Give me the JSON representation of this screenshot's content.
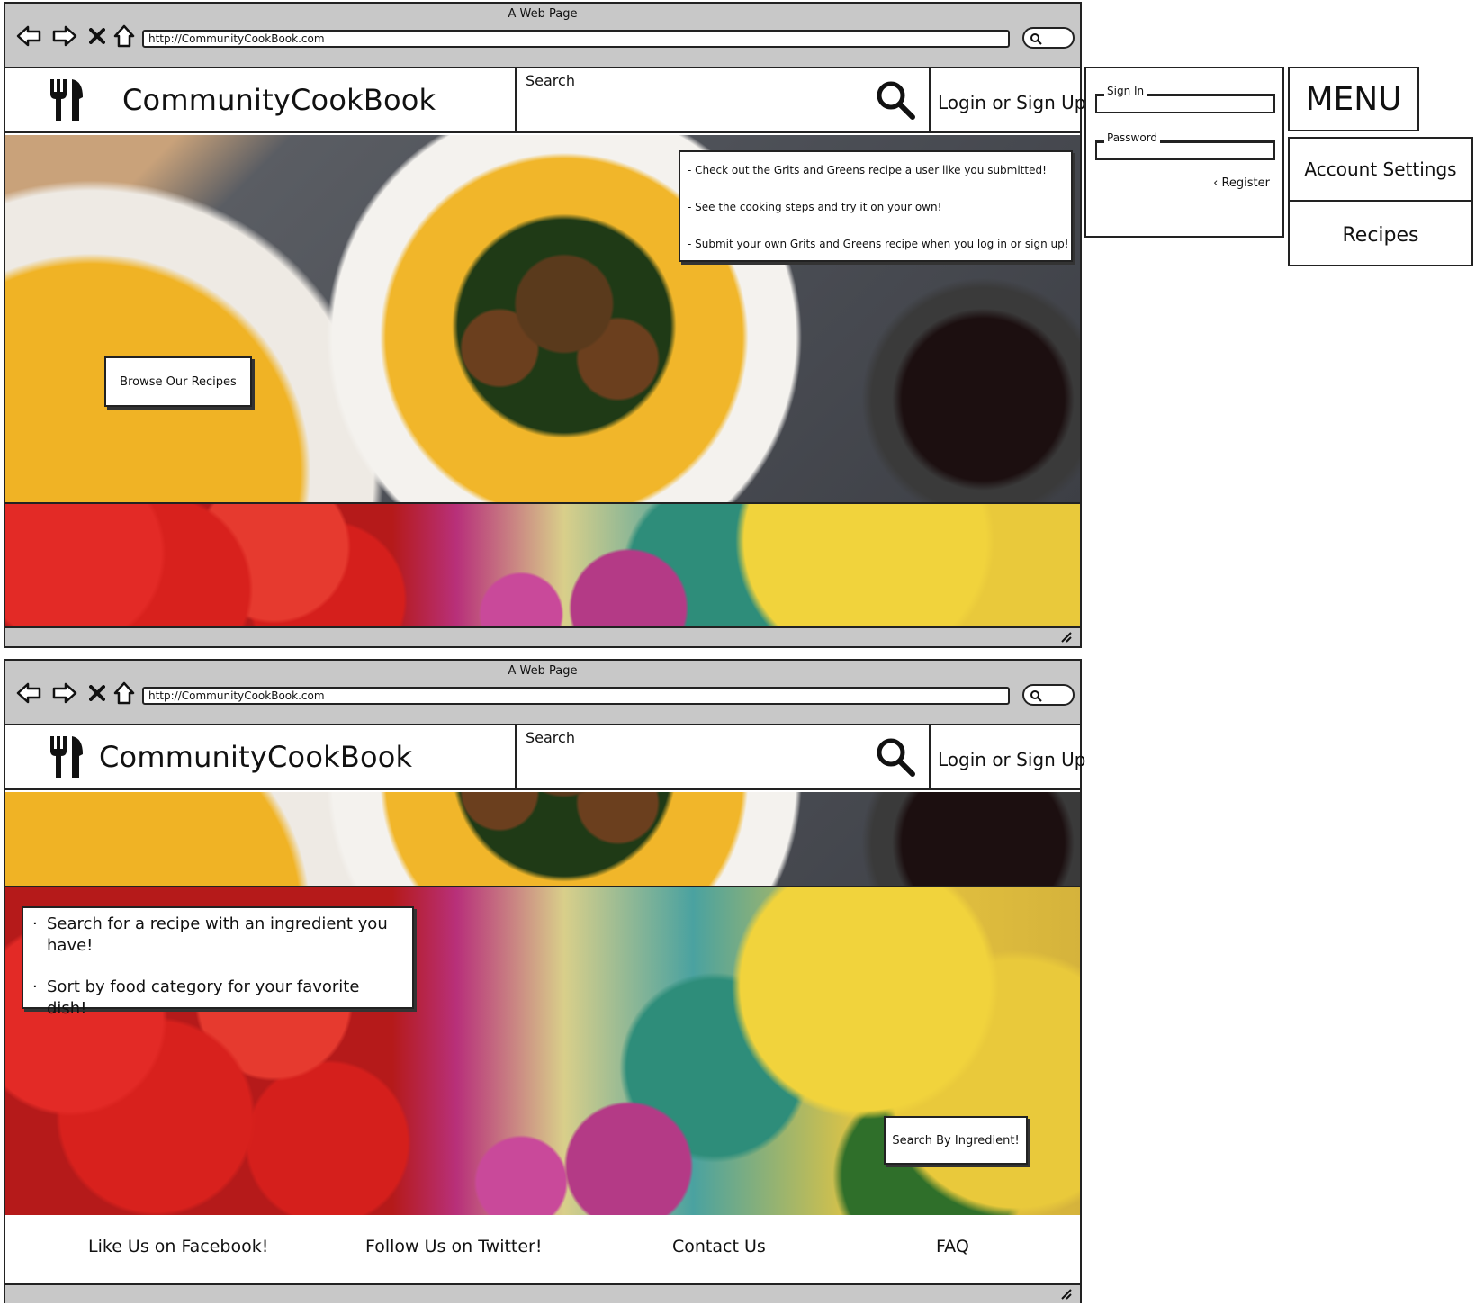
{
  "browser": {
    "window_title": "A Web Page",
    "url": "http://CommunityCookBook.com"
  },
  "header": {
    "site_title": "CommunityCookBook",
    "search_label": "Search",
    "login_label": "Login or Sign Up"
  },
  "hero": {
    "callout_lines": [
      "- Check out the Grits and Greens recipe a user like you submitted!",
      "- See the cooking steps and try it on your own!",
      "- Submit your own Grits and Greens recipe when you log in or sign up!"
    ],
    "browse_button": "Browse Our Recipes"
  },
  "signin": {
    "sign_in_label": "Sign In",
    "password_label": "Password",
    "register_label": "Register"
  },
  "menu": {
    "button_label": "MENU",
    "items": [
      "Account Settings",
      "Recipes"
    ]
  },
  "ingredients": {
    "bullets": [
      "Search for a recipe with an ingredient you have!",
      "Sort by food category for your favorite dish!"
    ],
    "search_button": "Search By Ingredient!"
  },
  "footer": {
    "links": [
      "Like Us on Facebook!",
      "Follow Us on Twitter!",
      "Contact Us",
      "FAQ"
    ]
  },
  "icons": {
    "back": "back-arrow-icon",
    "forward": "forward-arrow-icon",
    "stop": "close-icon",
    "home": "home-icon",
    "search": "search-icon",
    "logo": "fork-knife-icon",
    "register": "chevron-left-icon",
    "resize": "resize-grip-icon"
  }
}
